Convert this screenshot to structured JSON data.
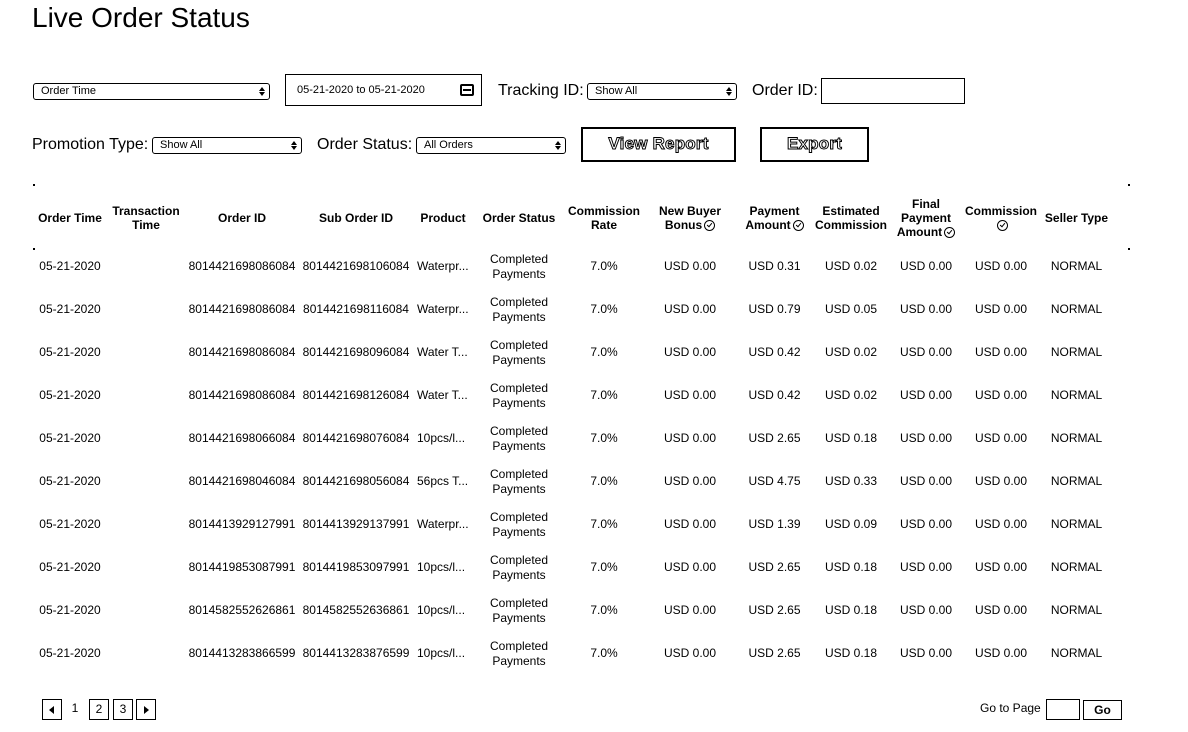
{
  "page_title": "Live Order Status",
  "filters": {
    "time_type": "Order Time",
    "date_range": "05-21-2020 to 05-21-2020",
    "tracking_id_label": "Tracking ID:",
    "tracking_id_value": "Show All",
    "order_id_label": "Order ID:",
    "order_id_value": "",
    "promotion_type_label": "Promotion Type:",
    "promotion_type_value": "Show All",
    "order_status_label": "Order Status:",
    "order_status_value": "All Orders",
    "view_report_label": "View Report",
    "export_label": "Export"
  },
  "table": {
    "headers": {
      "order_time": "Order Time",
      "transaction_time": "Transaction Time",
      "order_id": "Order ID",
      "sub_order_id": "Sub Order ID",
      "product": "Product",
      "order_status": "Order Status",
      "commission_rate": "Commission Rate",
      "new_buyer_bonus": "New Buyer Bonus",
      "payment_amount": "Payment Amount",
      "estimated_commission": "Estimated Commission",
      "final_payment_amount": "Final Payment Amount",
      "commission": "Commission",
      "seller_type": "Seller Type"
    },
    "rows": [
      {
        "order_time": "05-21-2020",
        "transaction_time": "",
        "order_id": "8014421698086084",
        "sub_order_id": "8014421698106084",
        "product": "Waterpr...",
        "status": "Completed Payments",
        "rate": "7.0%",
        "bonus": "USD 0.00",
        "payment": "USD 0.31",
        "est_commission": "USD 0.02",
        "final_payment": "USD 0.00",
        "commission": "USD 0.00",
        "seller_type": "NORMAL"
      },
      {
        "order_time": "05-21-2020",
        "transaction_time": "",
        "order_id": "8014421698086084",
        "sub_order_id": "8014421698116084",
        "product": "Waterpr...",
        "status": "Completed Payments",
        "rate": "7.0%",
        "bonus": "USD 0.00",
        "payment": "USD 0.79",
        "est_commission": "USD 0.05",
        "final_payment": "USD 0.00",
        "commission": "USD 0.00",
        "seller_type": "NORMAL"
      },
      {
        "order_time": "05-21-2020",
        "transaction_time": "",
        "order_id": "8014421698086084",
        "sub_order_id": "8014421698096084",
        "product": "Water T...",
        "status": "Completed Payments",
        "rate": "7.0%",
        "bonus": "USD 0.00",
        "payment": "USD 0.42",
        "est_commission": "USD 0.02",
        "final_payment": "USD 0.00",
        "commission": "USD 0.00",
        "seller_type": "NORMAL"
      },
      {
        "order_time": "05-21-2020",
        "transaction_time": "",
        "order_id": "8014421698086084",
        "sub_order_id": "8014421698126084",
        "product": "Water T...",
        "status": "Completed Payments",
        "rate": "7.0%",
        "bonus": "USD 0.00",
        "payment": "USD 0.42",
        "est_commission": "USD 0.02",
        "final_payment": "USD 0.00",
        "commission": "USD 0.00",
        "seller_type": "NORMAL"
      },
      {
        "order_time": "05-21-2020",
        "transaction_time": "",
        "order_id": "8014421698066084",
        "sub_order_id": "8014421698076084",
        "product": "10pcs/l...",
        "status": "Completed Payments",
        "rate": "7.0%",
        "bonus": "USD 0.00",
        "payment": "USD 2.65",
        "est_commission": "USD 0.18",
        "final_payment": "USD 0.00",
        "commission": "USD 0.00",
        "seller_type": "NORMAL"
      },
      {
        "order_time": "05-21-2020",
        "transaction_time": "",
        "order_id": "8014421698046084",
        "sub_order_id": "8014421698056084",
        "product": "56pcs T...",
        "status": "Completed Payments",
        "rate": "7.0%",
        "bonus": "USD 0.00",
        "payment": "USD 4.75",
        "est_commission": "USD 0.33",
        "final_payment": "USD 0.00",
        "commission": "USD 0.00",
        "seller_type": "NORMAL"
      },
      {
        "order_time": "05-21-2020",
        "transaction_time": "",
        "order_id": "8014413929127991",
        "sub_order_id": "8014413929137991",
        "product": "Waterpr...",
        "status": "Completed Payments",
        "rate": "7.0%",
        "bonus": "USD 0.00",
        "payment": "USD 1.39",
        "est_commission": "USD 0.09",
        "final_payment": "USD 0.00",
        "commission": "USD 0.00",
        "seller_type": "NORMAL"
      },
      {
        "order_time": "05-21-2020",
        "transaction_time": "",
        "order_id": "8014419853087991",
        "sub_order_id": "8014419853097991",
        "product": "10pcs/l...",
        "status": "Completed Payments",
        "rate": "7.0%",
        "bonus": "USD 0.00",
        "payment": "USD 2.65",
        "est_commission": "USD 0.18",
        "final_payment": "USD 0.00",
        "commission": "USD 0.00",
        "seller_type": "NORMAL"
      },
      {
        "order_time": "05-21-2020",
        "transaction_time": "",
        "order_id": "8014582552626861",
        "sub_order_id": "8014582552636861",
        "product": "10pcs/l...",
        "status": "Completed Payments",
        "rate": "7.0%",
        "bonus": "USD 0.00",
        "payment": "USD 2.65",
        "est_commission": "USD 0.18",
        "final_payment": "USD 0.00",
        "commission": "USD 0.00",
        "seller_type": "NORMAL"
      },
      {
        "order_time": "05-21-2020",
        "transaction_time": "",
        "order_id": "8014413283866599",
        "sub_order_id": "8014413283876599",
        "product": "10pcs/l...",
        "status": "Completed Payments",
        "rate": "7.0%",
        "bonus": "USD 0.00",
        "payment": "USD 2.65",
        "est_commission": "USD 0.18",
        "final_payment": "USD 0.00",
        "commission": "USD 0.00",
        "seller_type": "NORMAL"
      }
    ]
  },
  "pagination": {
    "pages": [
      "1",
      "2",
      "3"
    ],
    "current_page": "1",
    "goto_label": "Go to Page",
    "goto_value": "",
    "go_label": "Go"
  }
}
